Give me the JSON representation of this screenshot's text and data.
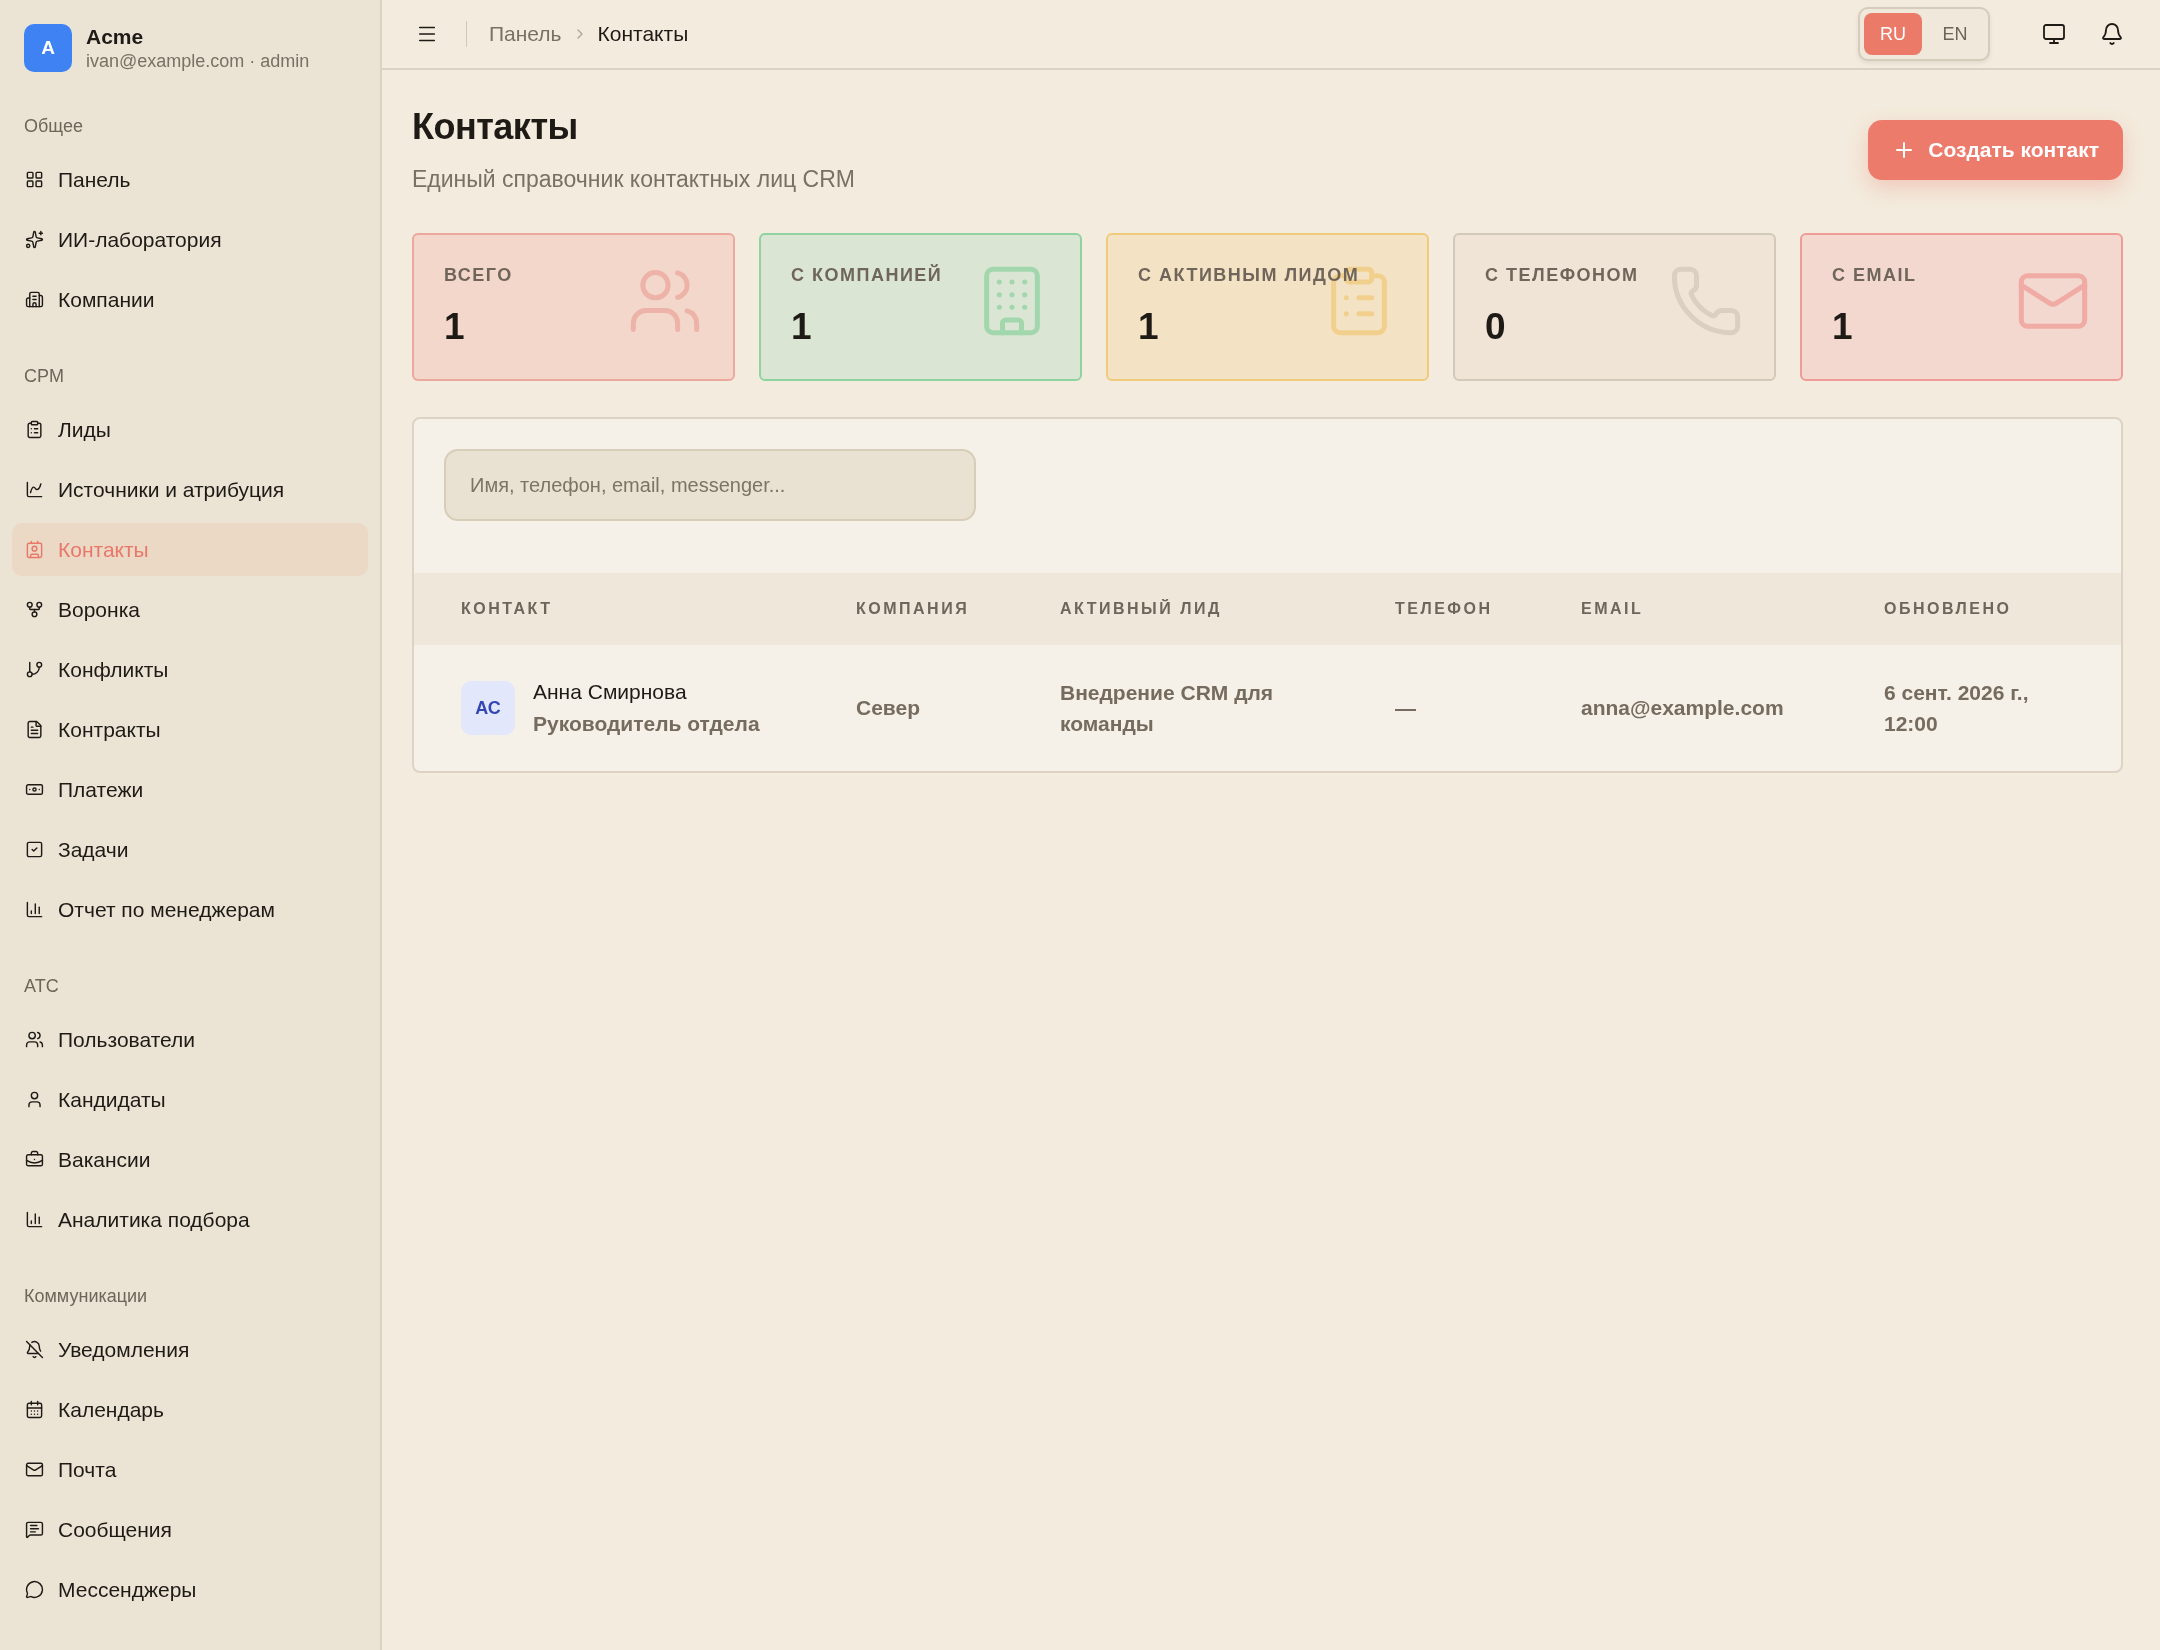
{
  "account": {
    "avatar": "A",
    "name": "Acme",
    "subtitle": "ivan@example.com · admin"
  },
  "sidebar": {
    "sections": [
      {
        "title": "Общее",
        "items": [
          {
            "label": "Панель",
            "selected": false
          },
          {
            "label": "ИИ-лаборатория",
            "selected": false
          },
          {
            "label": "Компании",
            "selected": false
          }
        ]
      },
      {
        "title": "CPM",
        "items": [
          {
            "label": "Лиды",
            "selected": false
          },
          {
            "label": "Источники и атрибуция",
            "selected": false
          },
          {
            "label": "Контакты",
            "selected": true
          },
          {
            "label": "Воронка",
            "selected": false
          },
          {
            "label": "Конфликты",
            "selected": false
          },
          {
            "label": "Контракты",
            "selected": false
          },
          {
            "label": "Платежи",
            "selected": false
          },
          {
            "label": "Задачи",
            "selected": false
          },
          {
            "label": "Отчет по менеджерам",
            "selected": false
          }
        ]
      },
      {
        "title": "ATC",
        "items": [
          {
            "label": "Пользователи",
            "selected": false
          },
          {
            "label": "Кандидаты",
            "selected": false
          },
          {
            "label": "Вакансии",
            "selected": false
          },
          {
            "label": "Аналитика подбора",
            "selected": false
          }
        ]
      },
      {
        "title": "Коммуникации",
        "items": [
          {
            "label": "Уведомления",
            "selected": false
          },
          {
            "label": "Календарь",
            "selected": false
          },
          {
            "label": "Почта",
            "selected": false
          },
          {
            "label": "Сообщения",
            "selected": false
          },
          {
            "label": "Мессенджеры",
            "selected": false
          }
        ]
      }
    ]
  },
  "breadcrumbs": [
    "Панель",
    "Контакты"
  ],
  "languages": [
    {
      "label": "RU",
      "selected": true
    },
    {
      "label": "EN",
      "selected": false
    }
  ],
  "page": {
    "title": "Контакты",
    "subtitle": "Единый справочник контактных лиц CRM",
    "create_button": "Создать контакт"
  },
  "stats": [
    {
      "label": "ВСЕГО",
      "value": "1",
      "color": "#eba89d"
    },
    {
      "label": "С КОМПАНИЕЙ",
      "value": "1",
      "color": "#8fd3a2"
    },
    {
      "label": "С АКТИВНЫМ ЛИДОМ",
      "value": "1",
      "color": "#f1cb7c"
    },
    {
      "label": "С ТЕЛЕФОНОМ",
      "value": "0",
      "color": "#d3c9b9"
    },
    {
      "label": "С EMAIL",
      "value": "1",
      "color": "#ef9c97"
    }
  ],
  "search": {
    "placeholder": "Имя, телефон, email, messenger..."
  },
  "table": {
    "columns": [
      "КОНТАКТ",
      "КОМПАНИЯ",
      "АКТИВНЫЙ ЛИД",
      "ТЕЛЕФОН",
      "EMAIL",
      "ОБНОВЛЕНО"
    ],
    "rows": [
      {
        "initials": "АС",
        "name": "Анна Смирнова",
        "position": "Руководитель отдела",
        "company": "Север",
        "lead": "Внедрение CRM для команды",
        "phone": "—",
        "email": "anna@example.com",
        "updated": "6 сент. 2026 г., 12:00"
      }
    ]
  }
}
